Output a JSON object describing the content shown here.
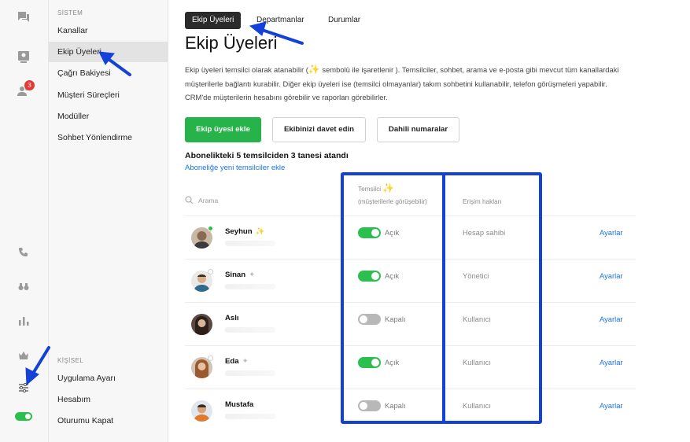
{
  "colors": {
    "accent_green": "#25b34a",
    "toggle_on": "#2bbf4e",
    "toggle_off": "#b8b8b8",
    "link_blue": "#1a73e8",
    "highlight_blue": "#1441d8",
    "badge_red": "#e53935"
  },
  "rail": {
    "icons": [
      "chat-icon",
      "inbox-icon",
      "users-icon",
      "phone-icon",
      "binoculars-icon",
      "bar-chart-icon",
      "crown-icon",
      "sliders-icon"
    ],
    "users_badge": "3"
  },
  "menu": {
    "system_section": "SİSTEM",
    "system_items": [
      "Kanallar",
      "Ekip Üyeleri",
      "Çağrı Bakiyesi",
      "Müşteri Süreçleri",
      "Modüller",
      "Sohbet Yönlendirme"
    ],
    "active_item": "Ekip Üyeleri",
    "personal_section": "KİŞİSEL",
    "personal_items": [
      "Uygulama Ayarı",
      "Hesabım",
      "Oturumu Kapat"
    ]
  },
  "tabs": [
    "Ekip Üyeleri",
    "Departmanlar",
    "Durumlar"
  ],
  "active_tab": "Ekip Üyeleri",
  "page": {
    "title": "Ekip Üyeleri",
    "desc_part1": "Ekip üyeleri temsilci olarak atanabilir (",
    "desc_spark": "✨",
    "desc_part2": " sembolü ile işaretlenir ). Temsilciler, sohbet, arama ve e-posta gibi mevcut tüm kanallardaki müşterilerle bağlantı kurabilir. Diğer ekip üyeleri ise (temsilci olmayanlar) takım sohbetini kullanabilir, telefon görüşmeleri yapabilir. CRM'de müşterilerin hesabını görebilir ve raporları görebilirler.",
    "buttons": {
      "add_member": "Ekip üyesi ekle",
      "invite_team": "Ekibinizi davet edin",
      "internal_numbers": "Dahili numaralar"
    },
    "subscription_text": "Abonelikteki 5 temsilciden 3 tanesi atandı",
    "subscription_link": "Aboneliğe yeni temsilciler ekle"
  },
  "table": {
    "search_placeholder": "Arama",
    "col_agent": "Temsilci",
    "col_agent_spark": "✨",
    "col_agent_sub": "(müşterilerle görüşebilir)",
    "col_access": "Erişim hakları",
    "settings_label": "Ayarlar",
    "rows": [
      {
        "name": "Seyhun",
        "agent_mark": "✨",
        "agent": true,
        "agent_label": "Açık",
        "access": "Hesap sahibi",
        "online": true
      },
      {
        "name": "Sinan",
        "agent_mark": "✦",
        "agent": true,
        "agent_label": "Açık",
        "access": "Yönetici",
        "online": false
      },
      {
        "name": "Aslı",
        "agent_mark": "",
        "agent": false,
        "agent_label": "Kapalı",
        "access": "Kullanıcı",
        "online": false
      },
      {
        "name": "Eda",
        "agent_mark": "✦",
        "agent": true,
        "agent_label": "Açık",
        "access": "Kullanıcı",
        "online": false
      },
      {
        "name": "Mustafa",
        "agent_mark": "",
        "agent": false,
        "agent_label": "Kapalı",
        "access": "Kullanıcı",
        "online": false
      }
    ]
  }
}
